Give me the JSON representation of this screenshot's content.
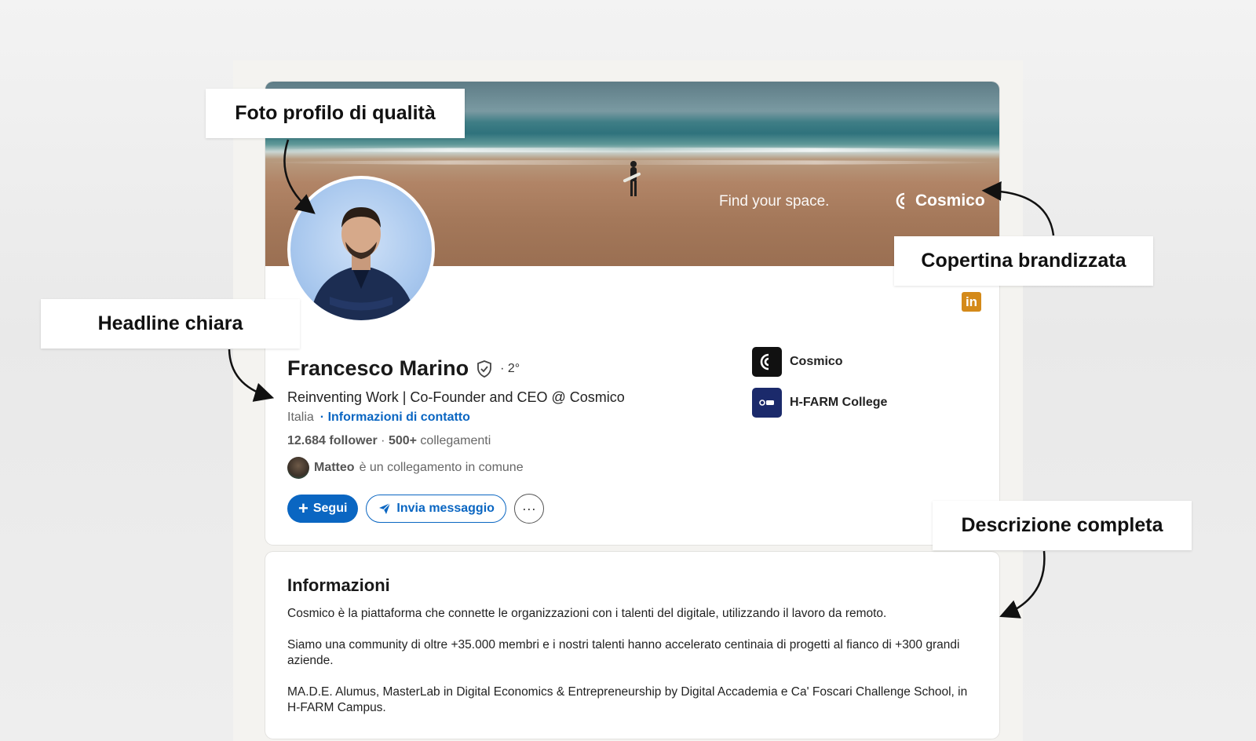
{
  "callouts": {
    "photo": "Foto profilo di qualità",
    "cover": "Copertina brandizzata",
    "headline": "Headline chiara",
    "description": "Descrizione completa"
  },
  "cover": {
    "tagline": "Find your space.",
    "brand": "Cosmico"
  },
  "profile": {
    "name": "Francesco Marino",
    "degree": "· 2°",
    "headline": "Reinventing Work | Co-Founder and CEO @ Cosmico",
    "location": "Italia",
    "contact_link": "· Informazioni di contatto",
    "followers": "12.684 follower",
    "separator": " · ",
    "connections_count": "500+",
    "connections_label": " collegamenti",
    "mutual_name": "Matteo",
    "mutual_text": "è un collegamento in comune"
  },
  "actions": {
    "follow": "Segui",
    "message": "Invia messaggio",
    "more": "···"
  },
  "companies": [
    {
      "name": "Cosmico",
      "logo_color": "#111111"
    },
    {
      "name": "H-FARM College",
      "logo_color": "#1b2a6b"
    }
  ],
  "linkedin_badge": "in",
  "about": {
    "title": "Informazioni",
    "paragraphs": [
      "Cosmico è la piattaforma che connette le organizzazioni con i talenti del digitale, utilizzando il lavoro da remoto.",
      "Siamo una community di oltre +35.000 membri e i nostri talenti hanno accelerato centinaia di progetti al fianco di +300 grandi aziende.",
      "MA.D.E. Alumus, MasterLab in Digital Economics & Entrepreneurship by Digital Accademia e Ca' Foscari Challenge School, in H-FARM Campus."
    ]
  },
  "colors": {
    "primary": "#0a66c2",
    "linkedin_badge": "#d48a1a"
  }
}
